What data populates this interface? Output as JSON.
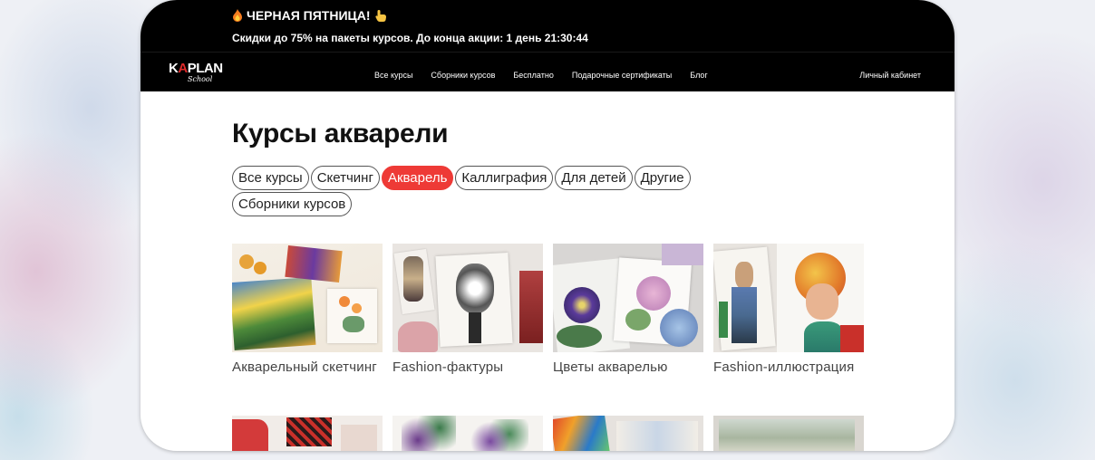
{
  "promo": {
    "title": "ЧЕРНАЯ ПЯТНИЦА!",
    "subtitle": "Скидки до 75% на пакеты курсов. До конца акции: 1 день 21:30:44"
  },
  "nav": {
    "logo_main": "KAPLAN",
    "logo_sub": "School",
    "items": [
      "Все курсы",
      "Сборники курсов",
      "Бесплатно",
      "Подарочные сертификаты",
      "Блог"
    ],
    "account": "Личный кабинет"
  },
  "page": {
    "title": "Курсы акварели",
    "chips": [
      "Все курсы",
      "Скетчинг",
      "Акварель",
      "Каллиграфия",
      "Для детей",
      "Другие",
      "Сборники курсов"
    ],
    "active_chip": "Акварель"
  },
  "courses": [
    {
      "name": "Акварельный скетчинг"
    },
    {
      "name": "Fashion-фактуры"
    },
    {
      "name": "Цветы акварелью"
    },
    {
      "name": "Fashion-иллюстрация"
    }
  ],
  "colors": {
    "accent": "#ee3a36",
    "header_bg": "#000000"
  }
}
